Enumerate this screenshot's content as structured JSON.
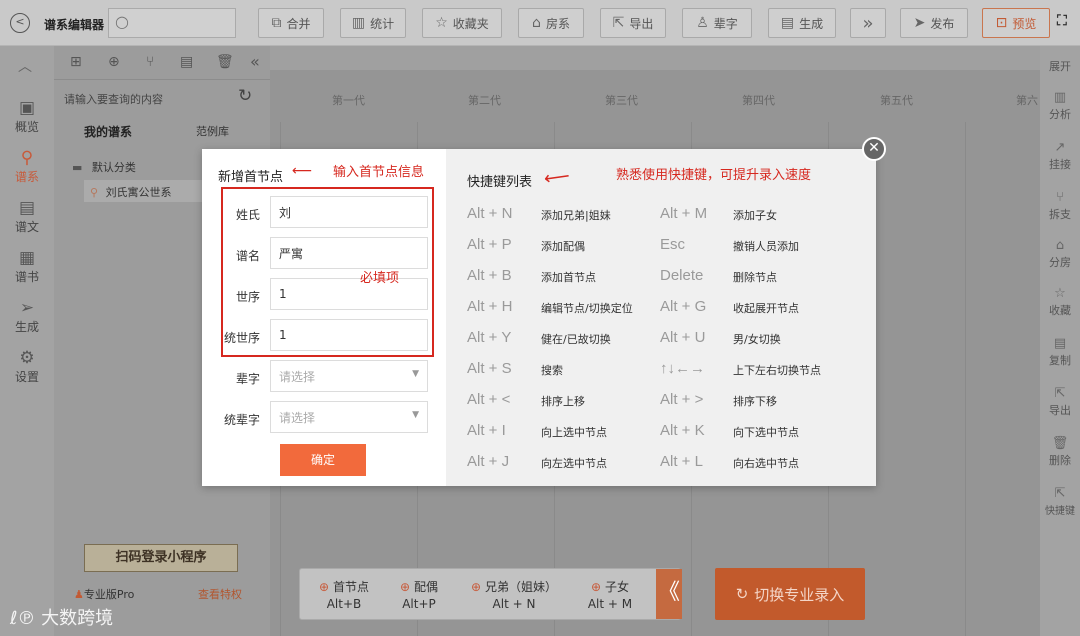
{
  "topbar": {
    "back_icon": "circle-left-icon",
    "title": "谱系编辑器",
    "search_icon": "search-icon",
    "buttons": [
      {
        "label": "合并",
        "icon": "merge-icon"
      },
      {
        "label": "统计",
        "icon": "bar-chart-icon"
      },
      {
        "label": "收藏夹",
        "icon": "star-icon"
      },
      {
        "label": "房系",
        "icon": "home-icon"
      },
      {
        "label": "导出",
        "icon": "export-icon"
      },
      {
        "label": "辈字",
        "icon": "person-icon"
      },
      {
        "label": "生成",
        "icon": "document-icon"
      },
      {
        "label": "发布",
        "icon": "send-icon"
      },
      {
        "label": "预览",
        "icon": "preview-icon"
      }
    ],
    "more_icon": "double-chevron-right-icon",
    "fullscreen_icon": "fullscreen-icon"
  },
  "leftnav": {
    "items": [
      {
        "label": "概览",
        "icon": "chart-icon"
      },
      {
        "label": "谱系",
        "icon": "tree-icon"
      },
      {
        "label": "谱文",
        "icon": "doc-icon"
      },
      {
        "label": "谱书",
        "icon": "book-icon"
      },
      {
        "label": "生成",
        "icon": "send-icon"
      },
      {
        "label": "设置",
        "icon": "gear-icon"
      }
    ]
  },
  "tree": {
    "search_placeholder": "请输入要查询的内容",
    "tabs": [
      "我的谱系",
      "范例库"
    ],
    "category": "默认分类",
    "node": "刘氏寓公世系",
    "qr_banner": "扫码登录小程序",
    "pro_label": "专业版Pro",
    "pro_link": "查看特权"
  },
  "main": {
    "generations": [
      "第一代",
      "第二代",
      "第三代",
      "第四代",
      "第五代",
      "第六"
    ]
  },
  "rightnav": {
    "items": [
      "展开",
      "分析",
      "挂接",
      "拆支",
      "分房",
      "收藏",
      "复制",
      "导出",
      "删除",
      "快捷键"
    ]
  },
  "modal": {
    "title": "新增首节点",
    "title_annotation": "输入首节点信息",
    "required_annotation": "必填项",
    "fields": [
      {
        "label": "姓氏",
        "value": "刘"
      },
      {
        "label": "谱名",
        "value": "严寓"
      },
      {
        "label": "世序",
        "value": "1"
      },
      {
        "label": "统世序",
        "value": "1"
      }
    ],
    "selects": [
      {
        "label": "辈字",
        "placeholder": "请选择"
      },
      {
        "label": "统辈字",
        "placeholder": "请选择"
      }
    ],
    "confirm": "确定",
    "shortcut_title": "快捷键列表",
    "shortcut_annotation": "熟悉使用快捷键，可提升录入速度",
    "shortcuts_left": [
      {
        "key": "Alt + N",
        "desc": "添加兄弟|姐妹"
      },
      {
        "key": "Alt + P",
        "desc": "添加配偶"
      },
      {
        "key": "Alt + B",
        "desc": "添加首节点"
      },
      {
        "key": "Alt + H",
        "desc": "编辑节点/切换定位"
      },
      {
        "key": "Alt + Y",
        "desc": "健在/已故切换"
      },
      {
        "key": "Alt + S",
        "desc": "搜索"
      },
      {
        "key": "Alt + <",
        "desc": "排序上移"
      },
      {
        "key": "Alt + I",
        "desc": "向上选中节点"
      },
      {
        "key": "Alt + J",
        "desc": "向左选中节点"
      }
    ],
    "shortcuts_right": [
      {
        "key": "Alt + M",
        "desc": "添加子女"
      },
      {
        "key": "Esc",
        "desc": "撤销人员添加"
      },
      {
        "key": "Delete",
        "desc": "删除节点"
      },
      {
        "key": "Alt + G",
        "desc": "收起展开节点"
      },
      {
        "key": "Alt + U",
        "desc": "男/女切换"
      },
      {
        "key": "↑↓←→",
        "desc": "上下左右切换节点"
      },
      {
        "key": "Alt + >",
        "desc": "排序下移"
      },
      {
        "key": "Alt + K",
        "desc": "向下选中节点"
      },
      {
        "key": "Alt + L",
        "desc": "向右选中节点"
      }
    ],
    "close_icon": "close-icon"
  },
  "bottom": {
    "items": [
      {
        "label": "首节点",
        "key": "Alt+B"
      },
      {
        "label": "配偶",
        "key": "Alt+P"
      },
      {
        "label": "兄弟（姐妹）",
        "key": "Alt + N"
      },
      {
        "label": "子女",
        "key": "Alt + M"
      }
    ],
    "switch_label": "切换专业录入"
  },
  "watermark": "大数跨境",
  "colors": {
    "accent": "#f26a3c",
    "annotation": "#d6281f"
  }
}
